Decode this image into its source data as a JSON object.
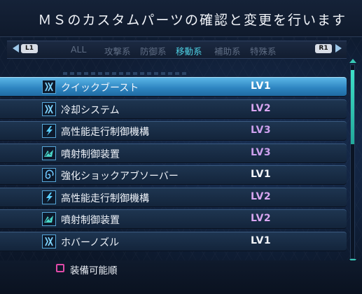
{
  "header": {
    "title": "ＭＳのカスタムパーツの確認と変更を行います"
  },
  "tabs": {
    "left_key": "L1",
    "right_key": "R1",
    "items": [
      {
        "label": "ALL",
        "active": false
      },
      {
        "label": "攻撃系",
        "active": false
      },
      {
        "label": "防御系",
        "active": false
      },
      {
        "label": "移動系",
        "active": true
      },
      {
        "label": "補助系",
        "active": false
      },
      {
        "label": "特殊系",
        "active": false
      }
    ]
  },
  "parts": [
    {
      "name": "クイックブースト",
      "level": "LV1",
      "icon": "thruster-icon",
      "selected": true
    },
    {
      "name": "冷却システム",
      "level": "LV2",
      "icon": "thruster-icon",
      "selected": false
    },
    {
      "name": "高性能走行制御機構",
      "level": "LV3",
      "icon": "lightning-icon",
      "selected": false
    },
    {
      "name": "噴射制御装置",
      "level": "LV3",
      "icon": "wing-icon",
      "selected": false
    },
    {
      "name": "強化ショックアブソーバー",
      "level": "LV1",
      "icon": "spiral-icon",
      "selected": false
    },
    {
      "name": "高性能走行制御機構",
      "level": "LV2",
      "icon": "lightning-icon",
      "selected": false
    },
    {
      "name": "噴射制御装置",
      "level": "LV2",
      "icon": "wing-icon",
      "selected": false
    },
    {
      "name": "ホバーノズル",
      "level": "LV1",
      "icon": "thruster-icon",
      "selected": false
    }
  ],
  "footer": {
    "sort_label": "装備可能順"
  },
  "colors": {
    "accent": "#4fd3e6",
    "selected_row": "#2f86c2",
    "level_high": "#d9a6f0"
  }
}
